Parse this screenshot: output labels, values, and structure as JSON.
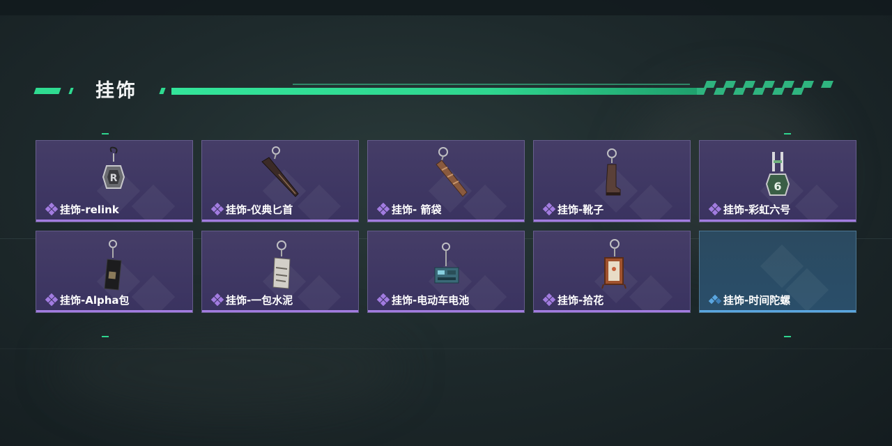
{
  "header": {
    "title": "挂饰"
  },
  "cards": [
    {
      "label": "挂饰-relink",
      "rarity": "purple",
      "icon": "relink-shield-charm-icon"
    },
    {
      "label": "挂饰-仪典匕首",
      "rarity": "purple",
      "icon": "ceremonial-dagger-charm-icon"
    },
    {
      "label": "挂饰- 箭袋",
      "rarity": "purple",
      "icon": "quiver-charm-icon"
    },
    {
      "label": "挂饰-靴子",
      "rarity": "purple",
      "icon": "boot-charm-icon"
    },
    {
      "label": "挂饰-彩虹六号",
      "rarity": "purple",
      "icon": "rainbow-six-charm-icon"
    },
    {
      "label": "挂饰-Alpha包",
      "rarity": "purple",
      "icon": "alpha-pack-charm-icon"
    },
    {
      "label": "挂饰-一包水泥",
      "rarity": "purple",
      "icon": "cement-bag-charm-icon"
    },
    {
      "label": "挂饰-电动车电池",
      "rarity": "purple",
      "icon": "battery-charm-icon"
    },
    {
      "label": "挂饰-拾花",
      "rarity": "purple",
      "icon": "flower-frame-charm-icon"
    },
    {
      "label": "挂饰-时间陀螺",
      "rarity": "blue",
      "icon": "none"
    }
  ],
  "colors": {
    "accent_green": "#2fdb91",
    "purple_rarity": "#a27ce0",
    "blue_rarity": "#5aa6e0"
  }
}
